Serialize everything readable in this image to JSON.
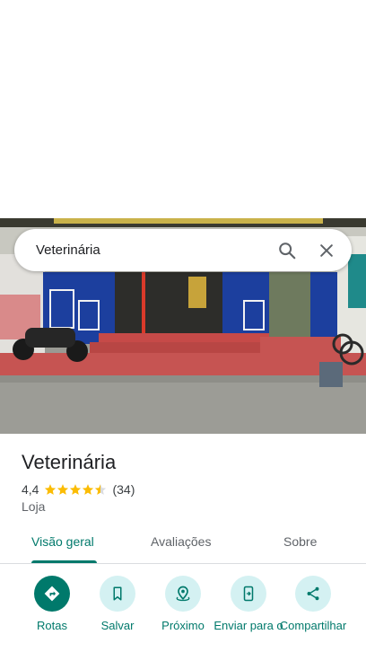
{
  "search": {
    "query": "Veterinária"
  },
  "place": {
    "name": "Veterinária",
    "rating": "4,4",
    "rating_value": 4.4,
    "review_count": "(34)",
    "category": "Loja"
  },
  "tabs": [
    {
      "label": "Visão geral",
      "active": true
    },
    {
      "label": "Avaliações",
      "active": false
    },
    {
      "label": "Sobre",
      "active": false
    }
  ],
  "actions": [
    {
      "label": "Rotas",
      "icon": "directions-icon"
    },
    {
      "label": "Salvar",
      "icon": "bookmark-icon"
    },
    {
      "label": "Próximo",
      "icon": "nearby-icon"
    },
    {
      "label": "Enviar para o",
      "icon": "send-to-phone-icon"
    },
    {
      "label": "Compartilhar",
      "icon": "share-icon"
    }
  ],
  "colors": {
    "accent": "#00796b",
    "action_bg": "#d4f1f2",
    "star": "#fbbc04"
  }
}
